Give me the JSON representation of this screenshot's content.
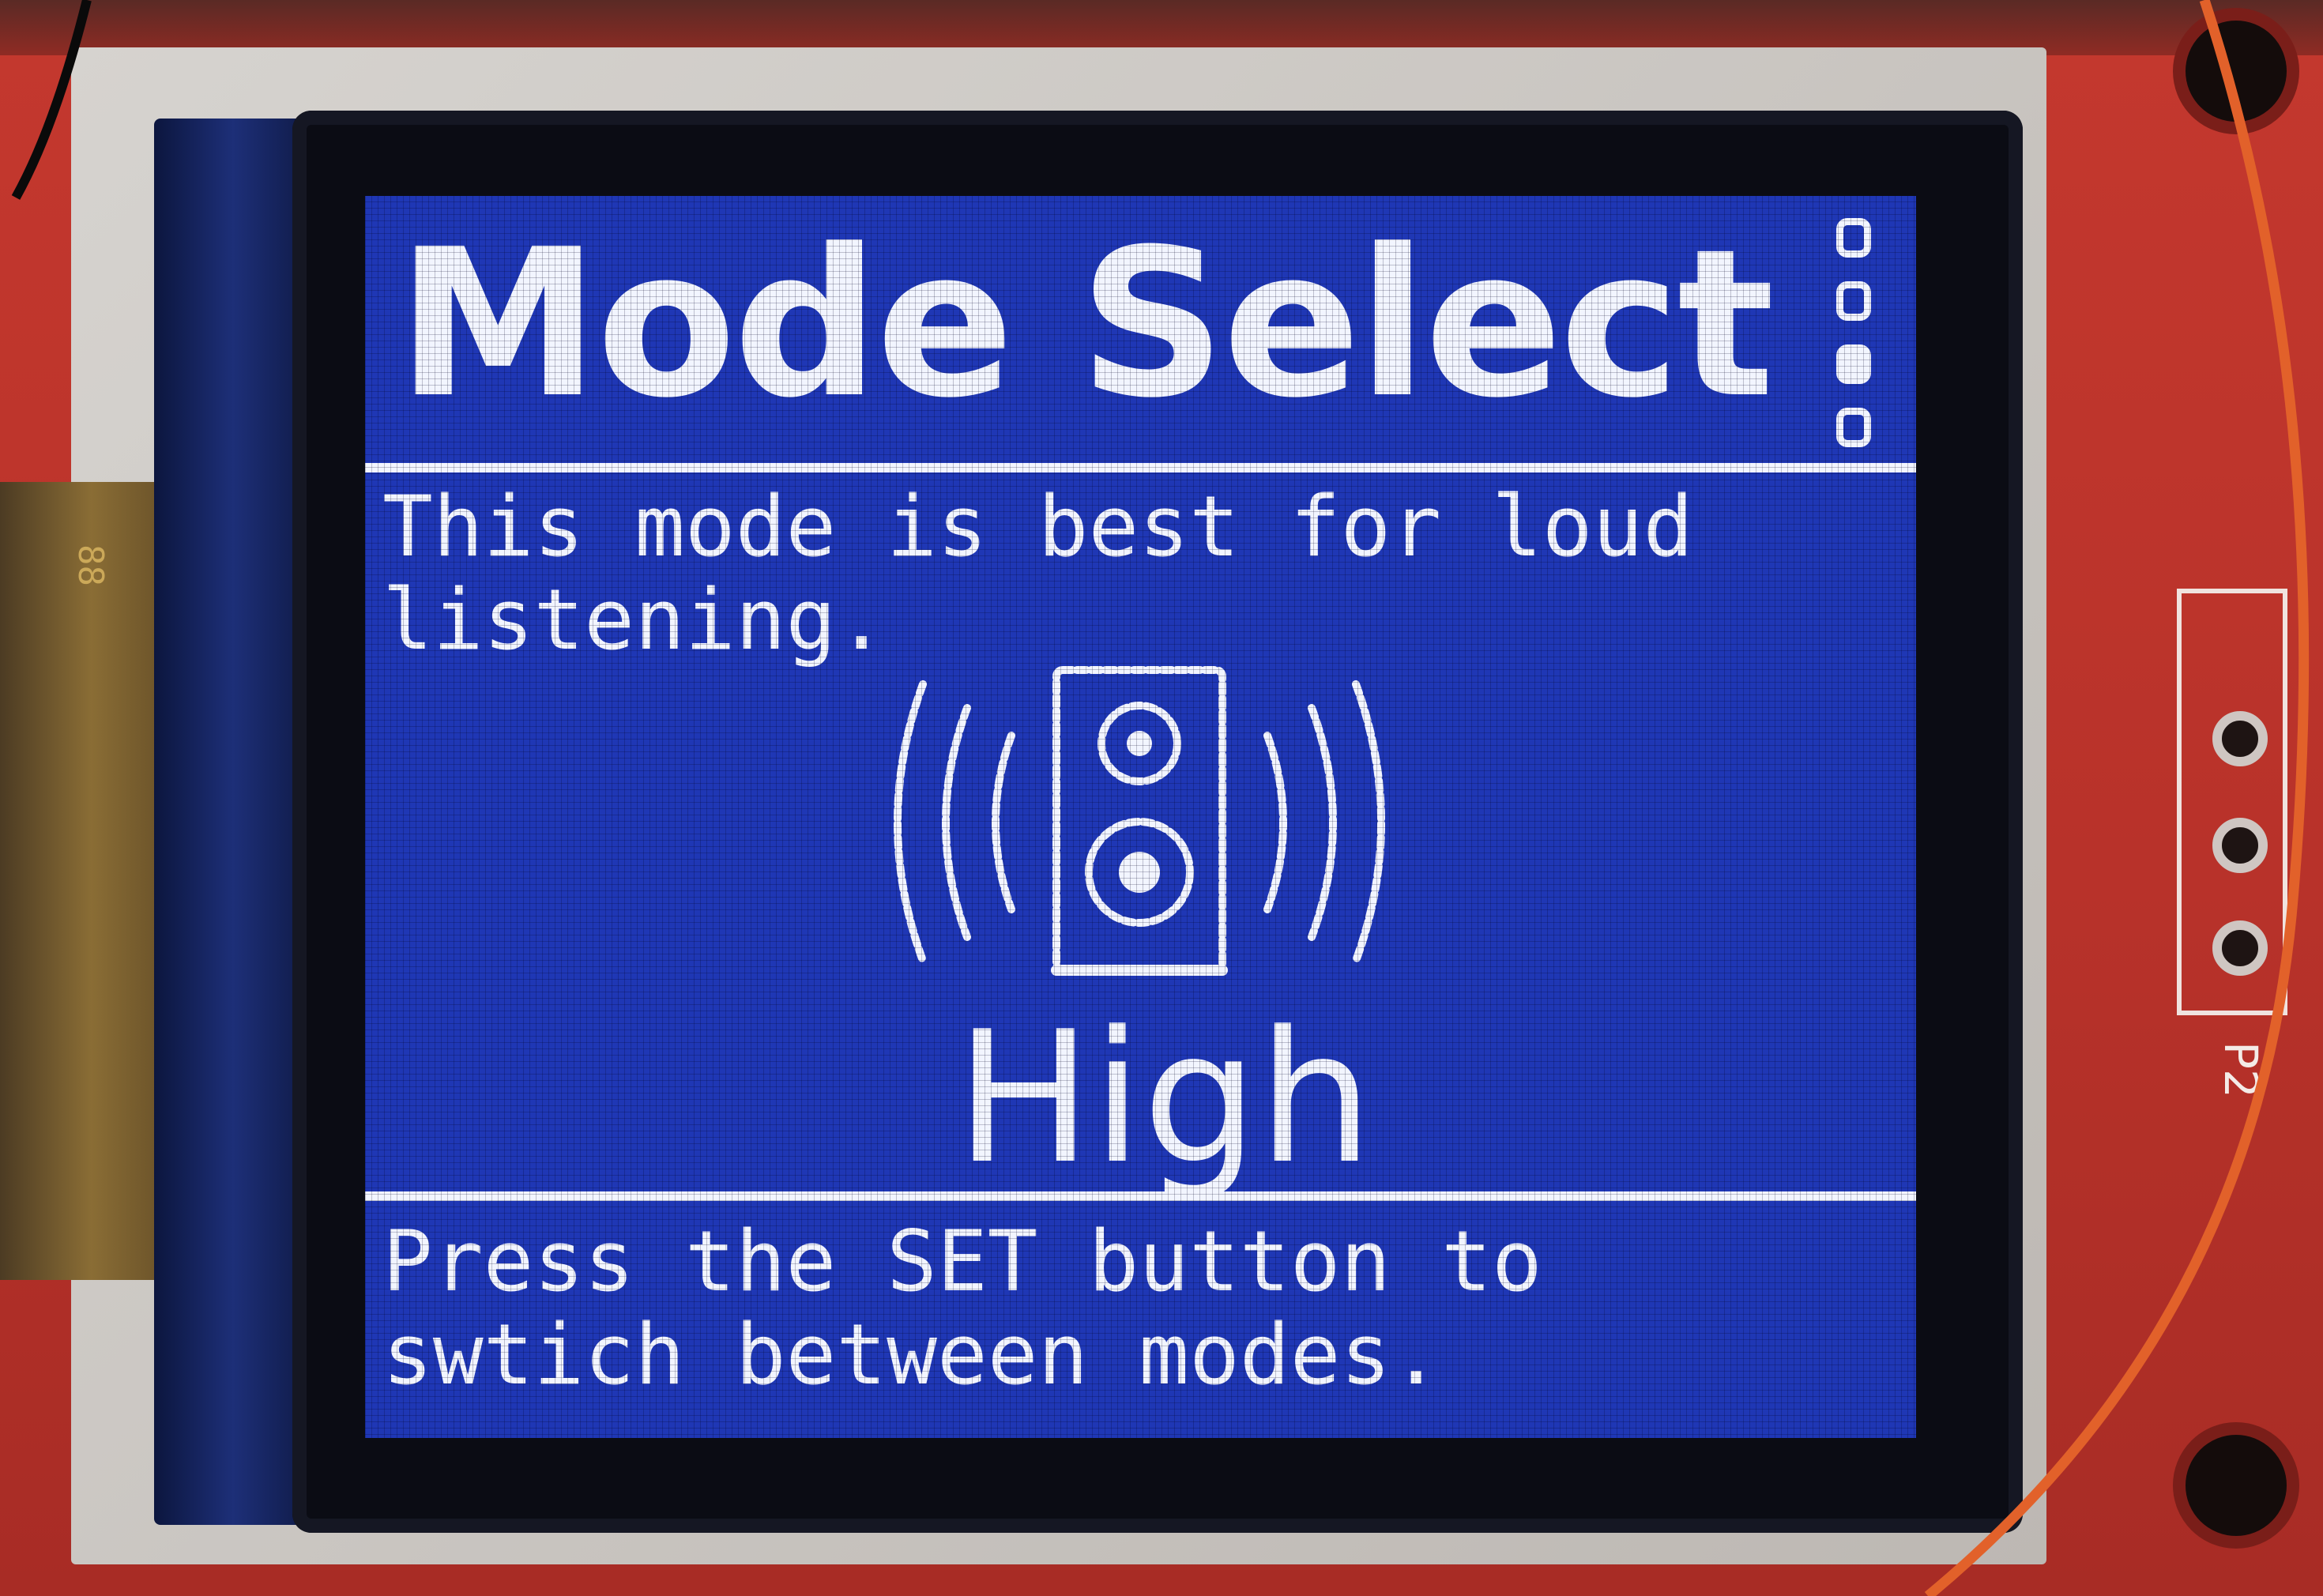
{
  "screen": {
    "title": "Mode Select",
    "description": "This mode is best for loud\nlistening.",
    "mode_value": "High",
    "hint": "Press the SET button to\nswtich between modes.",
    "page_indicator": [
      {
        "active": false
      },
      {
        "active": false
      },
      {
        "active": true
      },
      {
        "active": false
      }
    ],
    "icon": "speaker-sound-waves-icon"
  },
  "board": {
    "connector_label": "P2",
    "flex_label": "88"
  },
  "colors": {
    "screen_bg": "#1f37b5",
    "screen_fg": "#f2f5ff",
    "pcb": "#c4382e"
  }
}
